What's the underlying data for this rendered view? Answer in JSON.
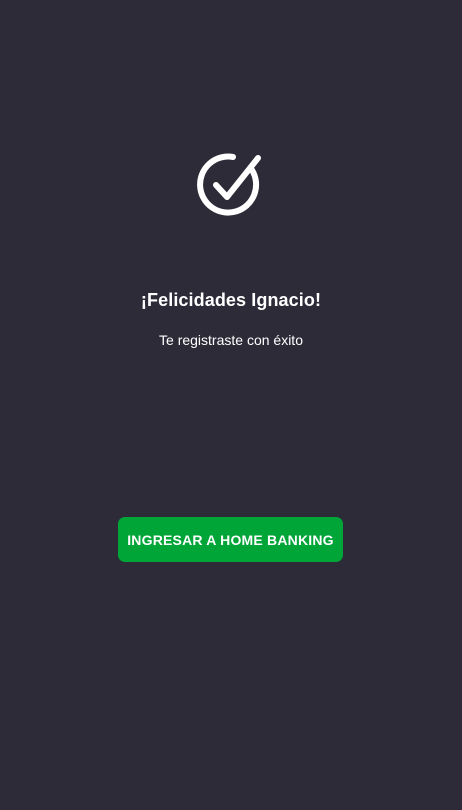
{
  "icon": "check-circle-icon",
  "colors": {
    "background": "#2d2b38",
    "button": "#00a538",
    "text": "#ffffff"
  },
  "success": {
    "title": "¡Felicidades Ignacio!",
    "message": "Te registraste con éxito"
  },
  "actions": {
    "primary_label": "INGRESAR A HOME BANKING"
  }
}
